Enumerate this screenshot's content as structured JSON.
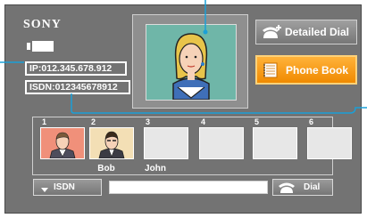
{
  "brand": "SONY",
  "status": {
    "ip_label": "IP:012.345.678.912",
    "isdn_label": "ISDN:012345678912"
  },
  "buttons": {
    "detailed_dial": "Detailed Dial",
    "phone_book": "Phone Book",
    "dial": "Dial"
  },
  "speed_dial": {
    "slots": [
      {
        "number": "1",
        "name": "Bob"
      },
      {
        "number": "2",
        "name": "John"
      },
      {
        "number": "3",
        "name": ""
      },
      {
        "number": "4",
        "name": ""
      },
      {
        "number": "5",
        "name": ""
      },
      {
        "number": "6",
        "name": ""
      }
    ]
  },
  "dial_bar": {
    "line_type": "ISDN",
    "number_value": ""
  },
  "colors": {
    "screen_bg": "#737373",
    "accent_orange": "#f7a01c",
    "leader_lines": "#1aa0d8"
  }
}
